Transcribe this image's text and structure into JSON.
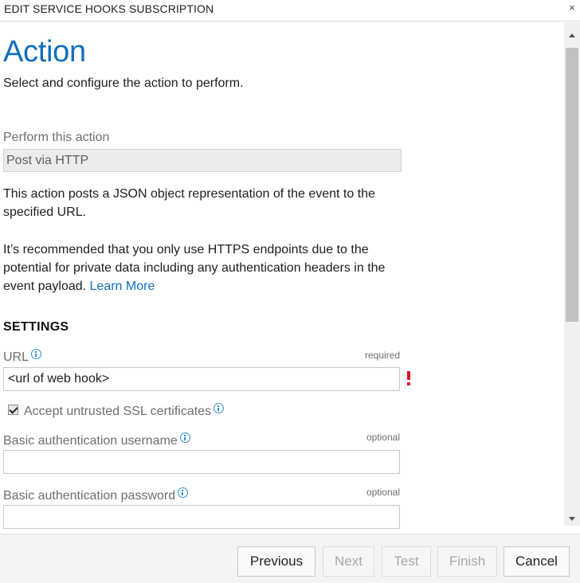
{
  "window": {
    "title": "EDIT SERVICE HOOKS SUBSCRIPTION",
    "close_glyph": "×"
  },
  "page": {
    "heading": "Action",
    "subtitle": "Select and configure the action to perform."
  },
  "action": {
    "label": "Perform this action",
    "value": "Post via HTTP",
    "description": "This action posts a JSON object representation of the event to the specified URL.",
    "recommendation": "It’s recommended that you only use HTTPS endpoints due to the potential for private data including any authentication headers in the event payload.",
    "learn_more": "Learn More"
  },
  "settings": {
    "heading": "SETTINGS",
    "url": {
      "label": "URL",
      "badge": "required",
      "value": "<url of web hook>"
    },
    "accept_ssl": {
      "label": "Accept untrusted SSL certificates",
      "checked": true
    },
    "username": {
      "label": "Basic authentication username",
      "badge": "optional",
      "value": ""
    },
    "password": {
      "label": "Basic authentication password",
      "badge": "optional",
      "value": ""
    }
  },
  "footer": {
    "previous": "Previous",
    "next": "Next",
    "test": "Test",
    "finish": "Finish",
    "cancel": "Cancel"
  },
  "colors": {
    "accent": "#106ebe",
    "error": "#e81123",
    "info_icon": "#2f8fd6"
  },
  "icons": {
    "close": "close-icon",
    "info": "info-icon",
    "error": "exclamation-icon",
    "checkbox": "checkbox-checked-icon"
  }
}
